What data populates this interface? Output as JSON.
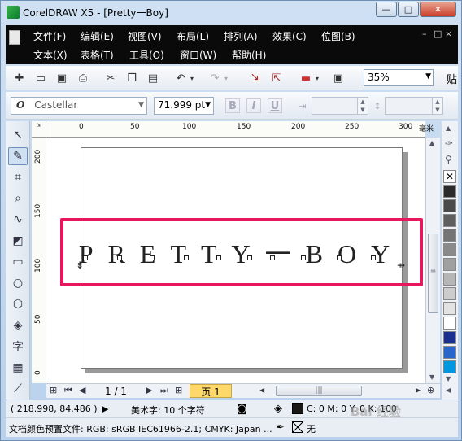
{
  "window": {
    "title": "CorelDRAW X5 - [Pretty一Boy]",
    "minimize": "—",
    "restore": "□",
    "close": "✕"
  },
  "menubar": {
    "row1": [
      "文件(F)",
      "编辑(E)",
      "视图(V)",
      "布局(L)",
      "排列(A)",
      "效果(C)",
      "位图(B)"
    ],
    "row2": [
      "文本(X)",
      "表格(T)",
      "工具(O)",
      "窗口(W)",
      "帮助(H)"
    ],
    "mdi": [
      "–",
      "□",
      "×"
    ]
  },
  "toolbar": {
    "zoom": "35%",
    "overflow_label": "贴"
  },
  "property_bar": {
    "font_name": "Castellar",
    "font_icon": "O",
    "font_size": "71.999 pt",
    "bold": "B",
    "italic": "I",
    "underline": "U"
  },
  "rulers": {
    "unit": "毫米",
    "top_ticks": [
      "0",
      "50",
      "100",
      "150",
      "200",
      "250",
      "300"
    ],
    "left_ticks": [
      "200",
      "150",
      "100",
      "50",
      "0"
    ]
  },
  "canvas": {
    "art_text": "PRETTY一BOY"
  },
  "page_nav": {
    "count": "1 / 1",
    "page_tab": "页 1"
  },
  "status": {
    "coords": "( 218.998, 84.486 )",
    "object_info": "美术字: 10 个字符",
    "fill_info": "C: 0 M: 0 Y: 0 K: 100",
    "color_profile": "文档颜色预置文件: RGB: sRGB IEC61966-2.1; CMYK: Japan ...",
    "outline_info": "无",
    "watermark": "Bai 经验"
  },
  "palette": {
    "colors": [
      "#ffffff",
      "#2b2b2b",
      "#4a4a4a",
      "#5f5f5f",
      "#747474",
      "#8a8a8a",
      "#a0a0a0",
      "#b6b6b6",
      "#cccccc",
      "#e3e3e3",
      "#ffffff",
      "#1b2f8f",
      "#2a66c9",
      "#0096e0"
    ]
  }
}
